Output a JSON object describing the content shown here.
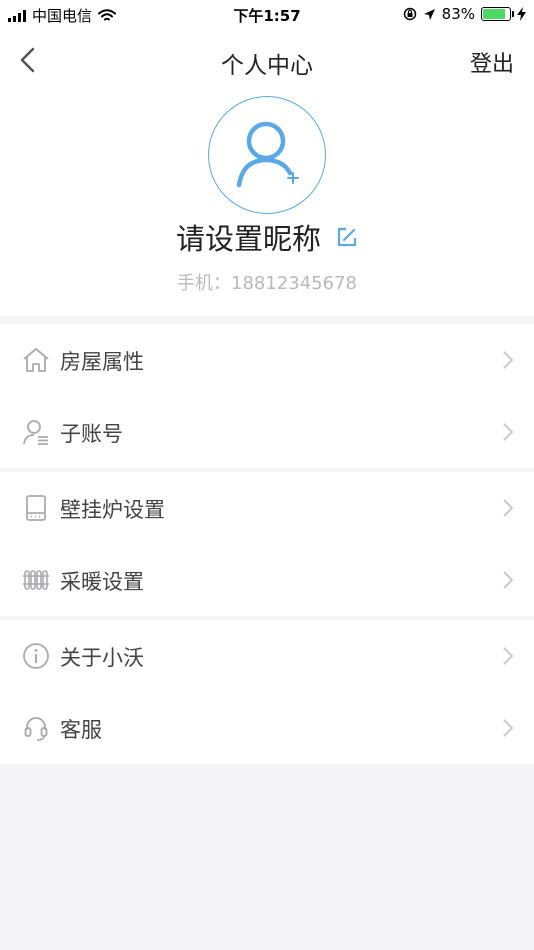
{
  "status_bar": {
    "carrier": "中国电信",
    "time": "下午1:57",
    "battery": "83%",
    "battery_level": 0.83
  },
  "navbar": {
    "title": "个人中心",
    "right_action": "登出"
  },
  "profile": {
    "nickname": "请设置昵称",
    "phone": "手机：18812345678"
  },
  "menu_groups": [
    {
      "items": [
        {
          "label": "房屋属性",
          "icon": "house-icon"
        },
        {
          "label": "子账号",
          "icon": "sub-account-icon"
        }
      ]
    },
    {
      "items": [
        {
          "label": "壁挂炉设置",
          "icon": "boiler-icon"
        },
        {
          "label": "采暖设置",
          "icon": "radiator-icon"
        }
      ]
    },
    {
      "items": [
        {
          "label": "关于小沃",
          "icon": "info-icon"
        },
        {
          "label": "客服",
          "icon": "headset-icon"
        }
      ]
    }
  ],
  "colors": {
    "accent": "#5aa9e6",
    "icon_gray": "#a9aab0",
    "background": "#f5f5f7"
  }
}
